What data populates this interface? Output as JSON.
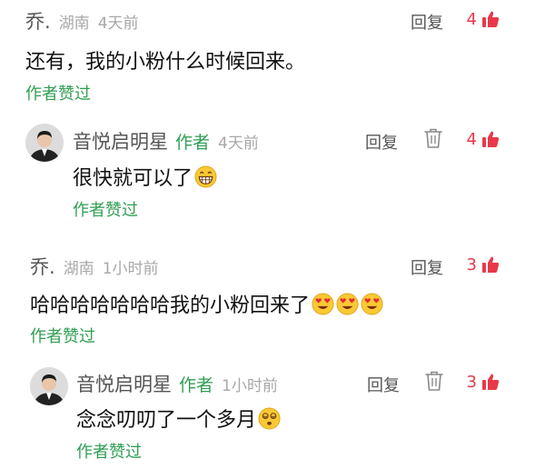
{
  "comments": [
    {
      "username": "乔.",
      "location": "湖南",
      "time": "4天前",
      "body": "还有，我的小粉什么时候回来。",
      "reply_label": "回复",
      "likes": "4",
      "liked_by_author": "作者赞过"
    },
    {
      "username": "音悦启明星",
      "author_tag": "作者",
      "time": "4天前",
      "body": "很快就可以了",
      "emoji": "grinning-face",
      "reply_label": "回复",
      "likes": "4",
      "liked_by_author": "作者赞过"
    },
    {
      "username": "乔.",
      "location": "湖南",
      "time": "1小时前",
      "body": "哈哈哈哈哈哈哈我的小粉回来了",
      "emoji": "heart-eyes-face",
      "reply_label": "回复",
      "likes": "3",
      "liked_by_author": "作者赞过"
    },
    {
      "username": "音悦启明星",
      "author_tag": "作者",
      "time": "1小时前",
      "body": "念念叨叨了一个多月",
      "emoji": "dizzy-face",
      "reply_label": "回复",
      "likes": "3",
      "liked_by_author": "作者赞过"
    }
  ],
  "colors": {
    "author_green": "#2f9e53",
    "like_red": "#e8394a",
    "meta_gray": "#a8a8a8"
  }
}
